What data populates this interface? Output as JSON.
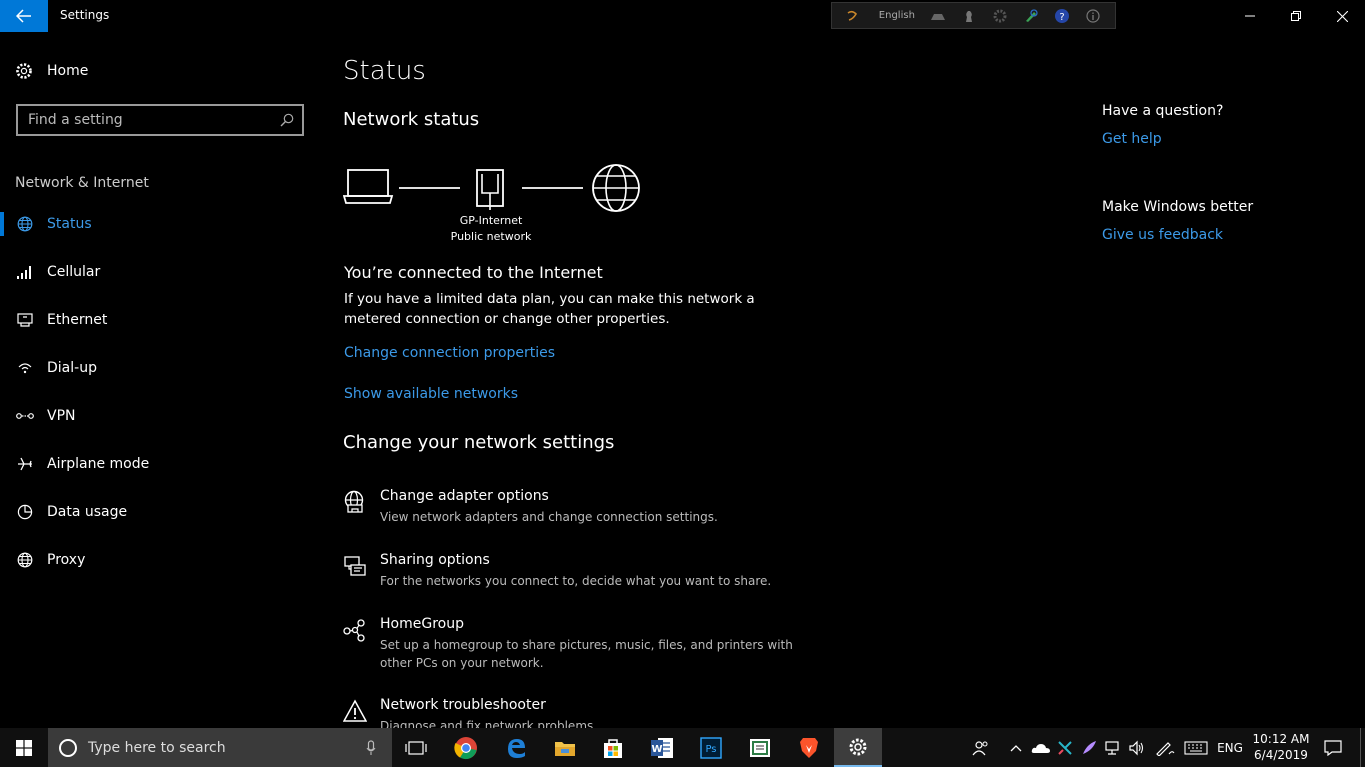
{
  "window": {
    "title": "Settings",
    "language_bar_text": "English"
  },
  "nav": {
    "home_label": "Home",
    "search_placeholder": "Find a setting",
    "section_label": "Network & Internet",
    "items": [
      {
        "label": "Status",
        "icon": "globe-icon",
        "active": true
      },
      {
        "label": "Cellular",
        "icon": "signal-bars-icon"
      },
      {
        "label": "Ethernet",
        "icon": "ethernet-icon"
      },
      {
        "label": "Dial-up",
        "icon": "dialup-icon"
      },
      {
        "label": "VPN",
        "icon": "vpn-icon"
      },
      {
        "label": "Airplane mode",
        "icon": "airplane-icon"
      },
      {
        "label": "Data usage",
        "icon": "pie-chart-icon"
      },
      {
        "label": "Proxy",
        "icon": "globe-icon"
      }
    ]
  },
  "main": {
    "page_title": "Status",
    "network_status_title": "Network status",
    "network_name": "GP-Internet",
    "network_type": "Public network",
    "connected_heading": "You’re connected to the Internet",
    "connected_desc": "If you have a limited data plan, you can make this network a metered connection or change other properties.",
    "link_change_props": "Change connection properties",
    "link_show_networks": "Show available networks",
    "change_settings_title": "Change your network settings",
    "settings": [
      {
        "title": "Change adapter options",
        "desc": "View network adapters and change connection settings.",
        "icon": "adapter-icon"
      },
      {
        "title": "Sharing options",
        "desc": "For the networks you connect to, decide what you want to share.",
        "icon": "sharing-icon"
      },
      {
        "title": "HomeGroup",
        "desc": "Set up a homegroup to share pictures, music, files, and printers with other PCs on your network.",
        "icon": "homegroup-icon"
      },
      {
        "title": "Network troubleshooter",
        "desc": "Diagnose and fix network problems.",
        "icon": "warning-icon"
      }
    ]
  },
  "right": {
    "question_heading": "Have a question?",
    "get_help": "Get help",
    "improve_heading": "Make Windows better",
    "feedback": "Give us feedback"
  },
  "taskbar": {
    "search_placeholder": "Type here to search",
    "language": "ENG",
    "time": "10:12 AM",
    "date": "6/4/2019",
    "apps": [
      "task-view-icon",
      "chrome-icon",
      "edge-icon",
      "file-explorer-icon",
      "store-icon",
      "word-icon",
      "photoshop-icon",
      "reader-icon",
      "brave-icon",
      "settings-gear-icon"
    ]
  },
  "colors": {
    "accent": "#0078d7",
    "link": "#3c9ae8",
    "background": "#000000",
    "taskbar": "#101010"
  }
}
